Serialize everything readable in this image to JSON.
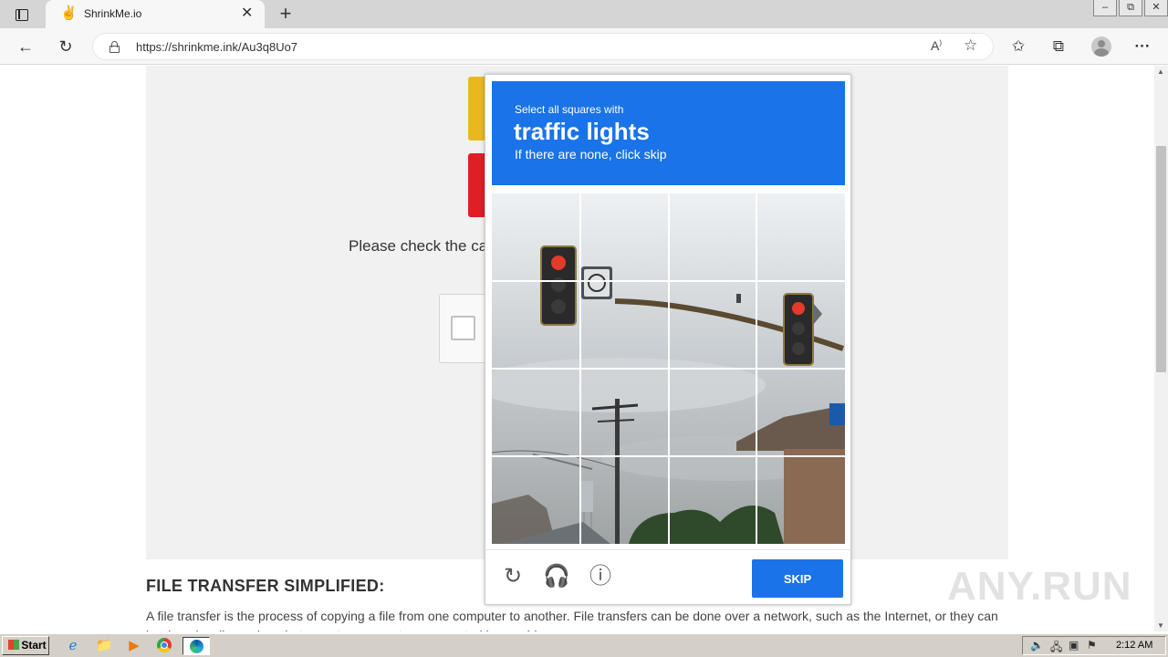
{
  "browser": {
    "tab_title": "ShrinkMe.io",
    "url": "https://shrinkme.ink/Au3q8Uo7",
    "window_controls": [
      "–",
      "⧉",
      "✕"
    ]
  },
  "page": {
    "check_text": "Please check the ca",
    "section_heading": "FILE TRANSFER SIMPLIFIED:",
    "section_body": "A file transfer is the process of copying a file from one computer to another. File transfers can be done over a network, such as the Internet, or they can be done locally, such as between two computers connected by a cable."
  },
  "captcha": {
    "instruction": "Select all squares with",
    "target": "traffic lights",
    "hint": "If there are none, click skip",
    "skip_label": "SKIP",
    "grid_size": 4
  },
  "watermark": "ANY.RUN",
  "taskbar": {
    "start_label": "Start",
    "clock": "2:12 AM"
  },
  "colors": {
    "captcha_blue": "#1a73e8",
    "panel_gray": "#f1f1f1",
    "taskbar": "#d4d0c8"
  }
}
